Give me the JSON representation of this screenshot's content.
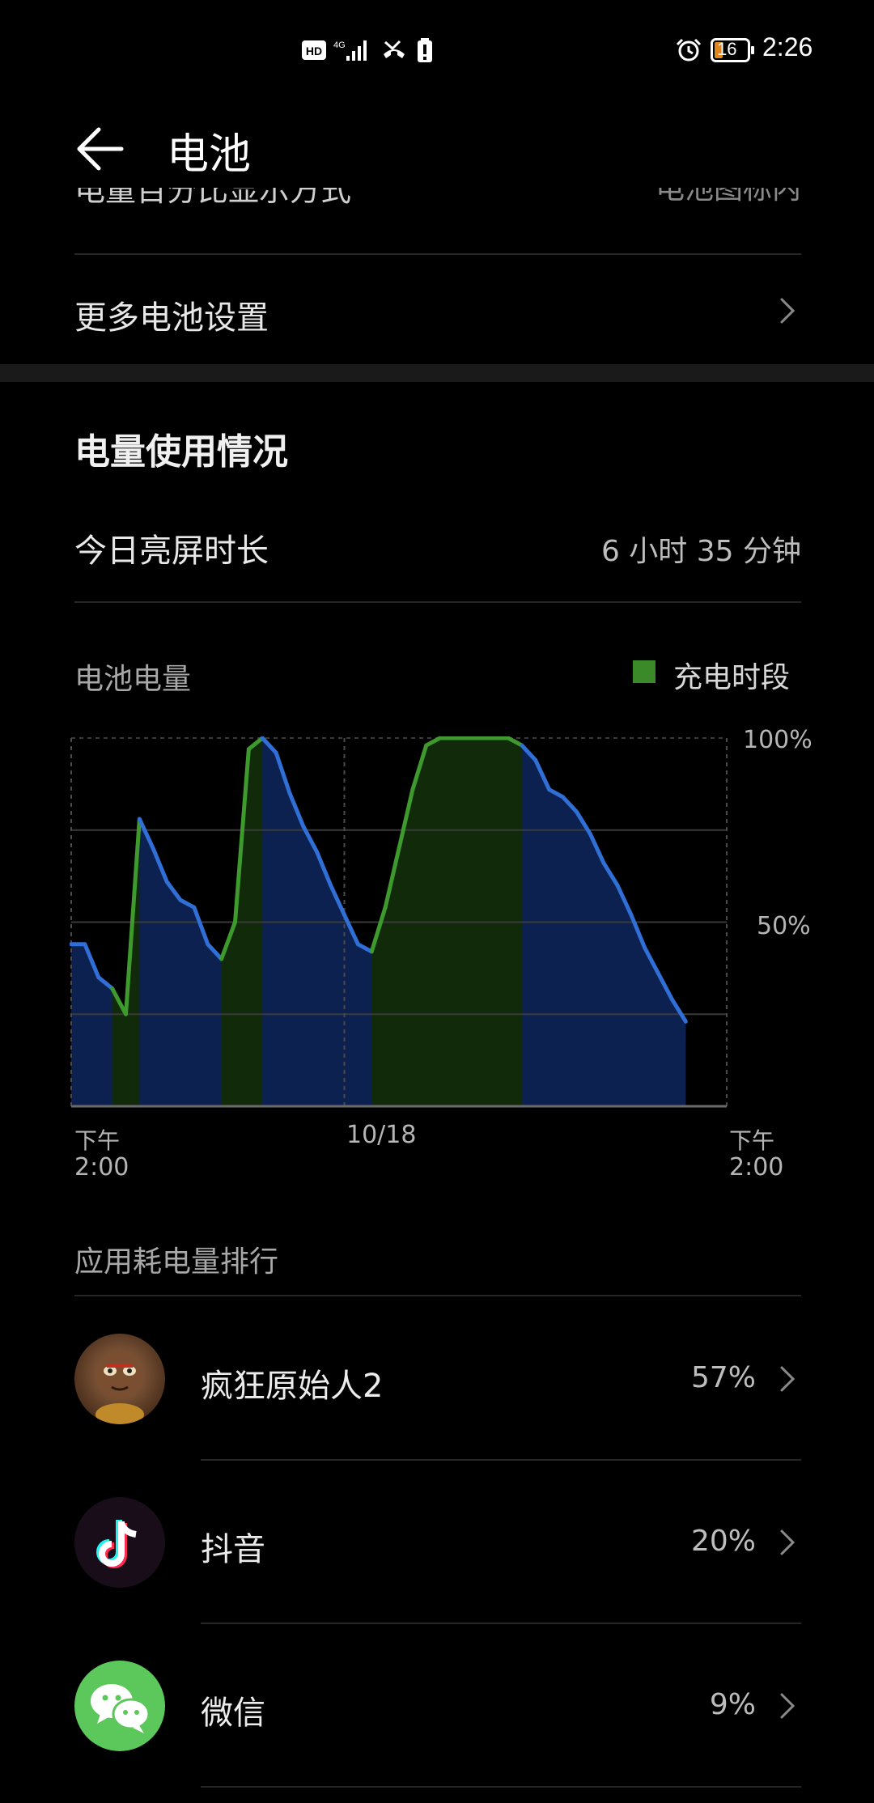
{
  "status_bar": {
    "time": "2:26",
    "battery_level": "16",
    "icons": [
      "hd-icon",
      "4g-signal-icon",
      "missed-call-icon",
      "battery-alert-icon",
      "alarm-icon",
      "battery-icon"
    ]
  },
  "header": {
    "title": "电池"
  },
  "settings": {
    "clipped_row_label": "电量百分比显示方式",
    "clipped_row_value": "电池图标内",
    "more_battery_settings": "更多电池设置"
  },
  "usage": {
    "section_title": "电量使用情况",
    "screen_time_label": "今日亮屏时长",
    "screen_time_value": "6 小时 35 分钟",
    "battery_level_label": "电池电量",
    "legend_charging": "充电时段"
  },
  "chart_data": {
    "type": "area",
    "title": "电池电量",
    "x_label_start": [
      "下午",
      "2:00"
    ],
    "x_label_mid": "10/18",
    "x_label_end": [
      "下午",
      "2:00"
    ],
    "x_range_hours": [
      0,
      24
    ],
    "y_range_percent": [
      0,
      100
    ],
    "y_ticks": [
      "100%",
      "50%"
    ],
    "grid": true,
    "legend": [
      {
        "name": "充电时段",
        "color": "#3a8a2a"
      }
    ],
    "series_color": "#2f6fd6",
    "charging_color": "#3f9a2e",
    "points": [
      [
        0,
        44
      ],
      [
        0.5,
        44
      ],
      [
        1,
        35
      ],
      [
        1.5,
        32
      ],
      [
        2,
        25
      ],
      [
        2.5,
        78
      ],
      [
        3,
        70
      ],
      [
        3.5,
        61
      ],
      [
        4,
        56
      ],
      [
        4.5,
        54
      ],
      [
        5,
        44
      ],
      [
        5.5,
        40
      ],
      [
        6,
        50
      ],
      [
        6.5,
        97
      ],
      [
        7,
        100
      ],
      [
        7.5,
        96
      ],
      [
        8,
        85
      ],
      [
        8.5,
        76
      ],
      [
        9,
        69
      ],
      [
        9.5,
        60
      ],
      [
        10,
        52
      ],
      [
        10.5,
        44
      ],
      [
        11,
        42
      ],
      [
        11.5,
        54
      ],
      [
        12,
        70
      ],
      [
        12.5,
        86
      ],
      [
        13,
        98
      ],
      [
        13.5,
        100
      ],
      [
        14,
        100
      ],
      [
        14.5,
        100
      ],
      [
        15,
        100
      ],
      [
        15.5,
        100
      ],
      [
        16,
        100
      ],
      [
        16.5,
        98
      ],
      [
        17,
        94
      ],
      [
        17.5,
        86
      ],
      [
        18,
        84
      ],
      [
        18.5,
        80
      ],
      [
        19,
        74
      ],
      [
        19.5,
        66
      ],
      [
        20,
        60
      ],
      [
        20.5,
        52
      ],
      [
        21,
        43
      ],
      [
        21.5,
        36
      ],
      [
        22,
        29
      ],
      [
        22.5,
        23
      ]
    ],
    "charging_periods": [
      [
        1.5,
        2.5
      ],
      [
        5.5,
        7
      ],
      [
        11,
        16.5
      ]
    ]
  },
  "ranking": {
    "title": "应用耗电量排行",
    "apps": [
      {
        "name": "疯狂原始人2",
        "percent": "57%",
        "icon": "game-character-icon"
      },
      {
        "name": "抖音",
        "percent": "20%",
        "icon": "tiktok-icon"
      },
      {
        "name": "微信",
        "percent": "9%",
        "icon": "wechat-icon"
      }
    ]
  }
}
